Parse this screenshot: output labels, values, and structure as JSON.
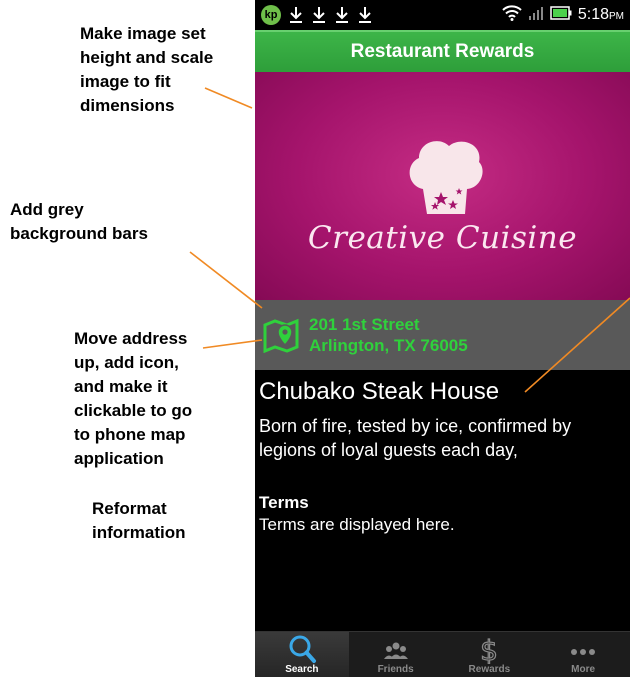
{
  "annotations": {
    "image_note": [
      "Make image set",
      "height and scale",
      "image to fit",
      "dimensions"
    ],
    "bars_note": [
      "Add grey",
      "background bars"
    ],
    "address_note": [
      "Move address",
      "up, add icon,",
      "and make it",
      "clickable to go",
      "to phone map",
      "application"
    ],
    "reformat_note": [
      "Reformat",
      "information"
    ],
    "arrow_color": "#f08a24"
  },
  "statusbar": {
    "app_badge": "kp",
    "time": "5:18",
    "ampm": "PM"
  },
  "appbar": {
    "title": "Restaurant Rewards",
    "color": "#34a844"
  },
  "banner": {
    "brand": "Creative Cuisine",
    "bg": "#a5146c"
  },
  "address": {
    "line1": "201 1st Street",
    "line2": "Arlington, TX 76005",
    "text_color": "#2fd13c",
    "bar_color": "#595959"
  },
  "details": {
    "name": "Chubako Steak House",
    "desc_line1": "Born of fire, tested by ice, confirmed by",
    "desc_line2": "legions of loyal guests each day,",
    "terms_heading": "Terms",
    "terms_text": "Terms are displayed here."
  },
  "tabs": [
    {
      "label": "Search",
      "icon": "search-icon",
      "active": true
    },
    {
      "label": "Friends",
      "icon": "friends-icon",
      "active": false
    },
    {
      "label": "Rewards",
      "icon": "dollar-icon",
      "active": false
    },
    {
      "label": "More",
      "icon": "more-icon",
      "active": false
    }
  ]
}
